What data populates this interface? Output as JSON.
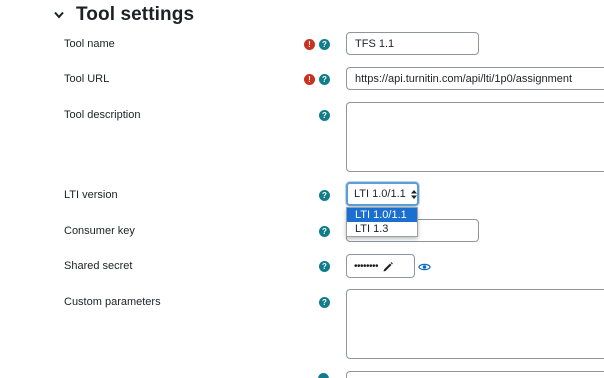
{
  "section": {
    "title": "Tool settings",
    "collapse_icon": "chevron-down-icon"
  },
  "fields": {
    "tool_name": {
      "label": "Tool name",
      "value": "TFS 1.1",
      "required": true
    },
    "tool_url": {
      "label": "Tool URL",
      "value": "https://api.turnitin.com/api/lti/1p0/assignment",
      "required": true
    },
    "tool_description": {
      "label": "Tool description",
      "value": ""
    },
    "lti_version": {
      "label": "LTI version",
      "selected": "LTI 1.0/1.1",
      "options": [
        "LTI 1.0/1.1",
        "LTI 1.3"
      ]
    },
    "consumer_key": {
      "label": "Consumer key",
      "value": ""
    },
    "shared_secret": {
      "label": "Shared secret",
      "masked_value": "••••••••"
    },
    "custom_parameters": {
      "label": "Custom parameters",
      "value": ""
    }
  },
  "icons": {
    "required": "!",
    "help": "?"
  },
  "colors": {
    "required_icon": "#ca3120",
    "help_icon": "#117d8a",
    "dropdown_selected": "#1a6fd1",
    "eye_icon": "#0f6cbf"
  }
}
